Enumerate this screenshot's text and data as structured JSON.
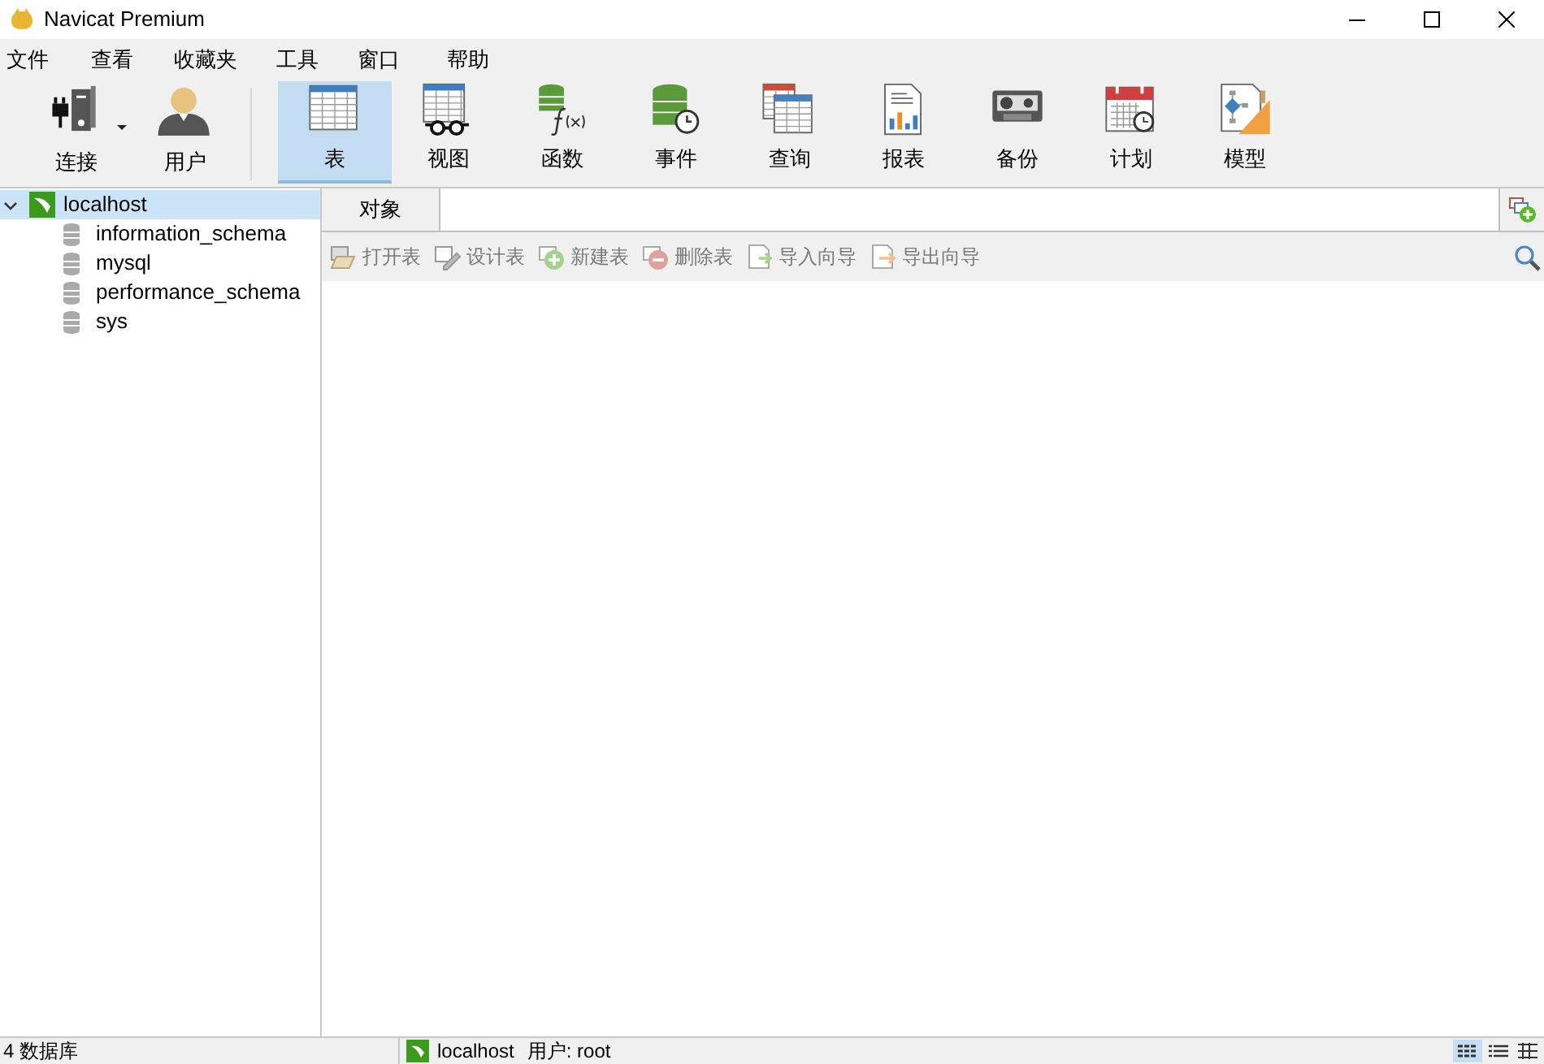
{
  "window": {
    "title": "Navicat Premium"
  },
  "menu": [
    "文件",
    "查看",
    "收藏夹",
    "工具",
    "窗口",
    "帮助"
  ],
  "toolbar_main": [
    {
      "kind": "connection",
      "label": "连接",
      "dropdown": true
    },
    {
      "kind": "user",
      "label": "用户",
      "dropdown": false
    }
  ],
  "toolbar_objects": [
    {
      "kind": "table",
      "label": "表",
      "selected": true
    },
    {
      "kind": "view",
      "label": "视图",
      "selected": false
    },
    {
      "kind": "function",
      "label": "函数",
      "selected": false
    },
    {
      "kind": "event",
      "label": "事件",
      "selected": false
    },
    {
      "kind": "query",
      "label": "查询",
      "selected": false
    },
    {
      "kind": "report",
      "label": "报表",
      "selected": false
    },
    {
      "kind": "backup",
      "label": "备份",
      "selected": false
    },
    {
      "kind": "schedule",
      "label": "计划",
      "selected": false
    },
    {
      "kind": "model",
      "label": "模型",
      "selected": false
    }
  ],
  "tree": [
    {
      "label": "localhost",
      "selected": true,
      "expanded": true,
      "children": [
        {
          "label": "information_schema"
        },
        {
          "label": "mysql"
        },
        {
          "label": "performance_schema"
        },
        {
          "label": "sys"
        }
      ]
    }
  ],
  "tabs": [
    {
      "label": "对象",
      "selected": true
    }
  ],
  "object_toolbar": [
    {
      "kind": "open",
      "label": "打开表",
      "disabled": true
    },
    {
      "kind": "design",
      "label": "设计表",
      "disabled": true
    },
    {
      "kind": "new",
      "label": "新建表",
      "disabled": true
    },
    {
      "kind": "delete",
      "label": "删除表",
      "disabled": true
    },
    {
      "kind": "import",
      "label": "导入向导",
      "disabled": true
    },
    {
      "kind": "export",
      "label": "导出向导",
      "disabled": true
    }
  ],
  "status_bar": {
    "count": "4 数据库",
    "connection": "localhost",
    "user": "用户: root"
  }
}
